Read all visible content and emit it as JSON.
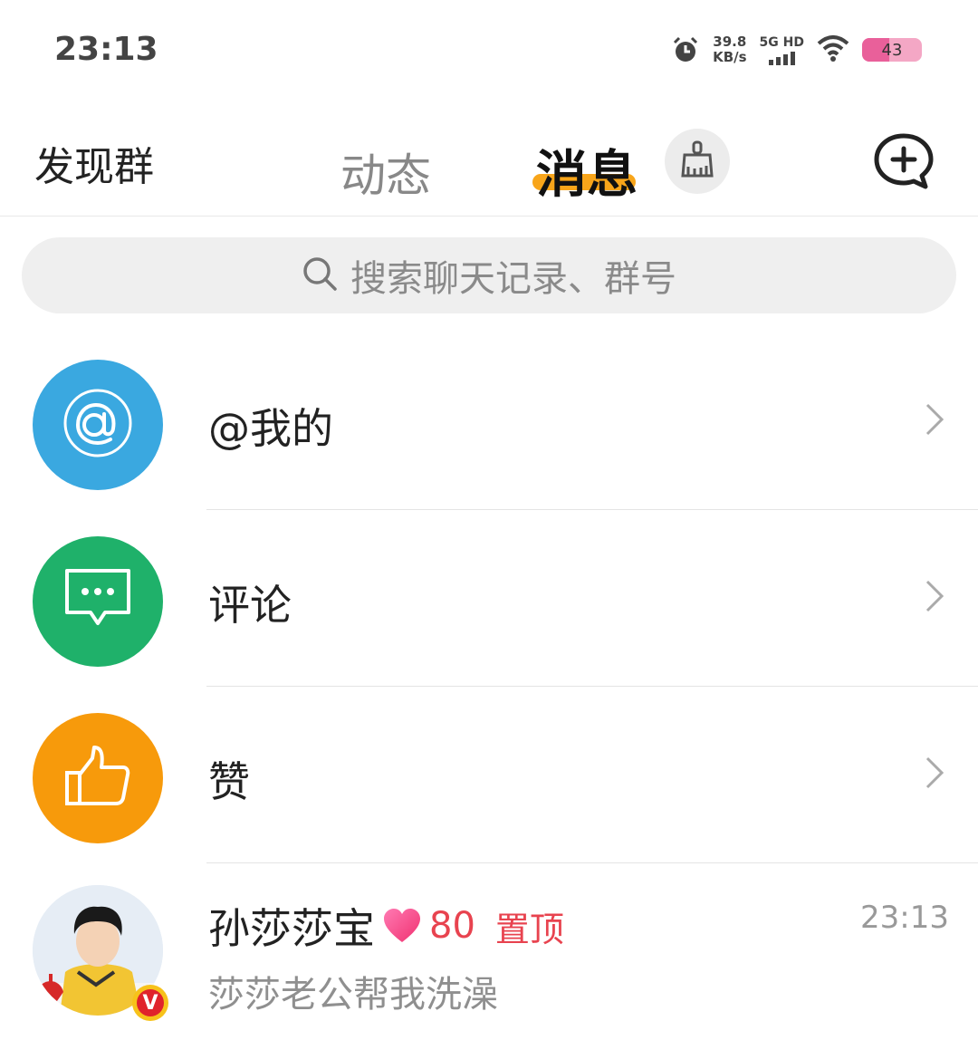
{
  "status_bar": {
    "time": "23:13",
    "net_speed_value": "39.8",
    "net_speed_unit": "KB/s",
    "network": "5G HD",
    "battery": "43"
  },
  "header": {
    "left_link": "发现群",
    "tabs": [
      "动态",
      "消息"
    ],
    "active_tab": "消息"
  },
  "search": {
    "placeholder": "搜索聊天记录、群号"
  },
  "entries": [
    {
      "label": "@我的",
      "color": "#3aa8e0",
      "icon": "at-icon"
    },
    {
      "label": "评论",
      "color": "#1fb16a",
      "icon": "comment-icon"
    },
    {
      "label": "赞",
      "color": "#f79a0b",
      "icon": "thumbs-up-icon"
    }
  ],
  "chat": {
    "name": "孙莎莎宝",
    "intimacy": "80",
    "pinned_label": "置顶",
    "time": "23:13",
    "preview": "莎莎老公帮我洗澡",
    "badge": "V"
  }
}
